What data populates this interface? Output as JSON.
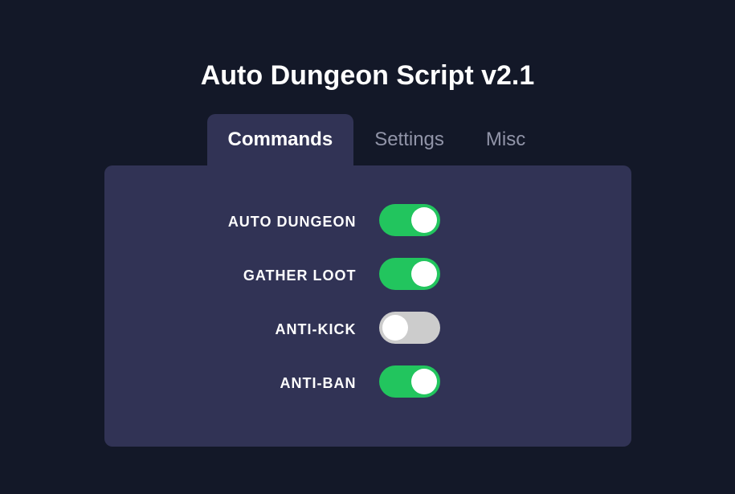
{
  "title": "Auto Dungeon Script v2.1",
  "tabs": [
    {
      "label": "Commands",
      "active": true
    },
    {
      "label": "Settings",
      "active": false
    },
    {
      "label": "Misc",
      "active": false
    }
  ],
  "options": [
    {
      "label": "AUTO DUNGEON",
      "enabled": true
    },
    {
      "label": "GATHER LOOT",
      "enabled": true
    },
    {
      "label": "ANTI-KICK",
      "enabled": false
    },
    {
      "label": "ANTI-BAN",
      "enabled": true
    }
  ],
  "colors": {
    "background": "#131828",
    "panel": "#313355",
    "toggle_on": "#22c55e",
    "toggle_off": "#cccccc",
    "tab_inactive": "#9194a8"
  }
}
